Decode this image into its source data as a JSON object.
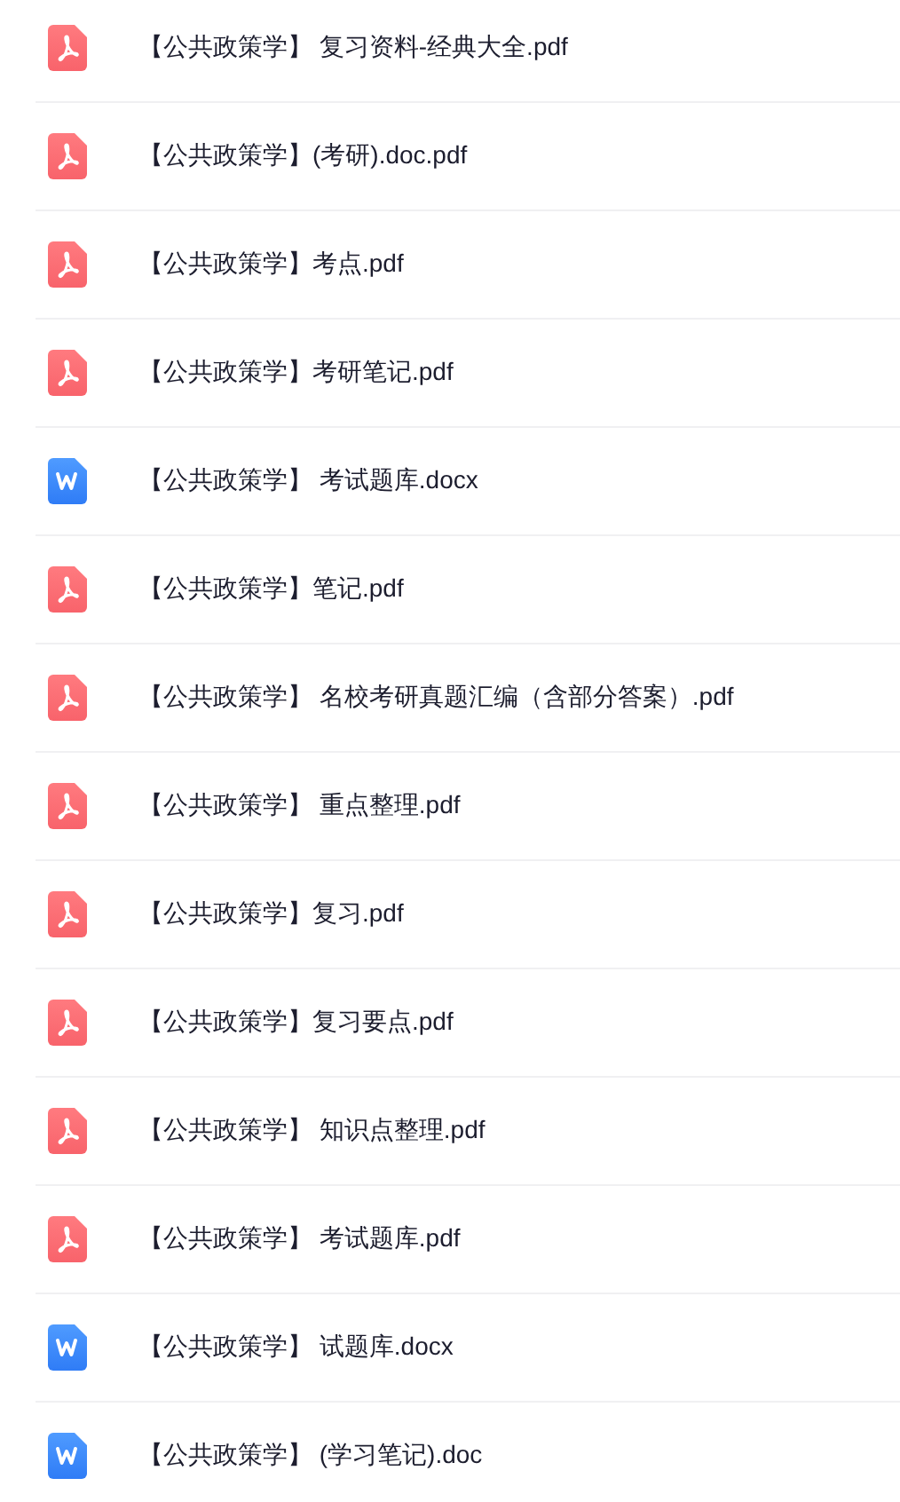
{
  "files": [
    {
      "kind": "pdf",
      "name": "【公共政策学】 复习资料-经典大全.pdf"
    },
    {
      "kind": "pdf",
      "name": "【公共政策学】(考研).doc.pdf"
    },
    {
      "kind": "pdf",
      "name": "【公共政策学】考点.pdf"
    },
    {
      "kind": "pdf",
      "name": "【公共政策学】考研笔记.pdf"
    },
    {
      "kind": "word",
      "name": "【公共政策学】 考试题库.docx"
    },
    {
      "kind": "pdf",
      "name": "【公共政策学】笔记.pdf"
    },
    {
      "kind": "pdf",
      "name": "【公共政策学】 名校考研真题汇编（含部分答案）.pdf"
    },
    {
      "kind": "pdf",
      "name": "【公共政策学】 重点整理.pdf"
    },
    {
      "kind": "pdf",
      "name": "【公共政策学】复习.pdf"
    },
    {
      "kind": "pdf",
      "name": "【公共政策学】复习要点.pdf"
    },
    {
      "kind": "pdf",
      "name": "【公共政策学】 知识点整理.pdf"
    },
    {
      "kind": "pdf",
      "name": "【公共政策学】 考试题库.pdf"
    },
    {
      "kind": "word",
      "name": "【公共政策学】 试题库.docx"
    },
    {
      "kind": "word",
      "name": "【公共政策学】 (学习笔记).doc"
    }
  ]
}
